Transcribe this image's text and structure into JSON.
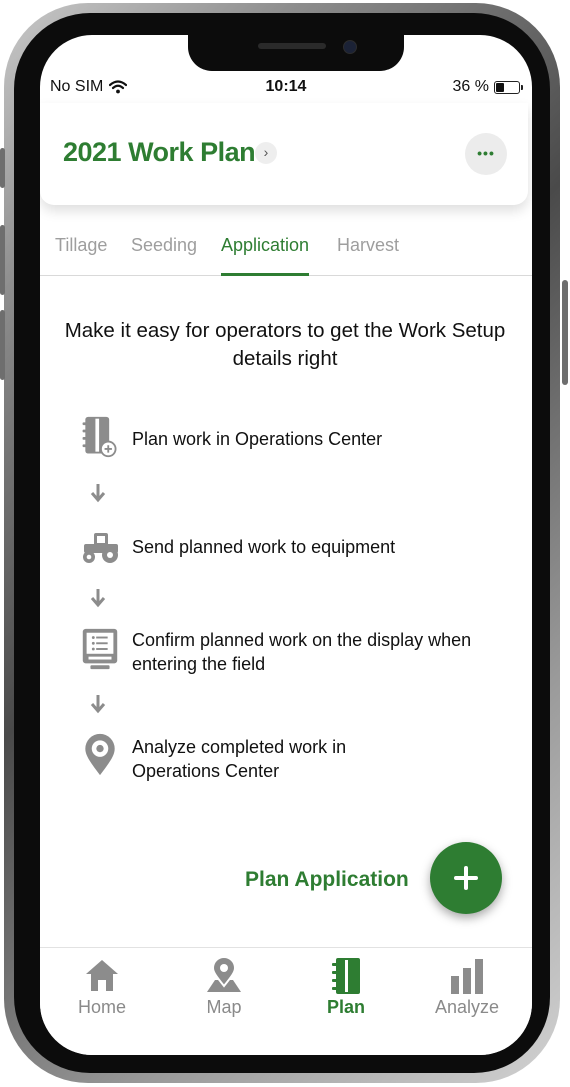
{
  "status_bar": {
    "carrier": "No SIM",
    "time": "10:14",
    "battery": "36 %"
  },
  "header": {
    "title": "2021 Work Plan",
    "chevron": "›",
    "more": "•••"
  },
  "tabs": [
    {
      "label": "Tillage",
      "active": false
    },
    {
      "label": "Seeding",
      "active": false
    },
    {
      "label": "Application",
      "active": true
    },
    {
      "label": "Harvest",
      "active": false
    }
  ],
  "headline": "Make it easy for operators to get the Work Setup details right",
  "steps": [
    {
      "icon": "plan-book-icon",
      "text": "Plan work in Operations Center"
    },
    {
      "icon": "tractor-icon",
      "text": "Send planned work to equipment"
    },
    {
      "icon": "display-icon",
      "text": "Confirm planned work on the display when entering the field"
    },
    {
      "icon": "location-pin-icon",
      "text": "Analyze completed work in Operations Center"
    }
  ],
  "fab": {
    "label": "Plan Application",
    "icon": "plus-icon"
  },
  "bottom_nav": [
    {
      "label": "Home",
      "icon": "home-icon",
      "active": false
    },
    {
      "label": "Map",
      "icon": "map-pin-icon",
      "active": false
    },
    {
      "label": "Plan",
      "icon": "plan-book-icon",
      "active": true
    },
    {
      "label": "Analyze",
      "icon": "bar-chart-icon",
      "active": false
    }
  ],
  "colors": {
    "accent": "#2e7d32",
    "inactive": "#9e9e9e"
  }
}
